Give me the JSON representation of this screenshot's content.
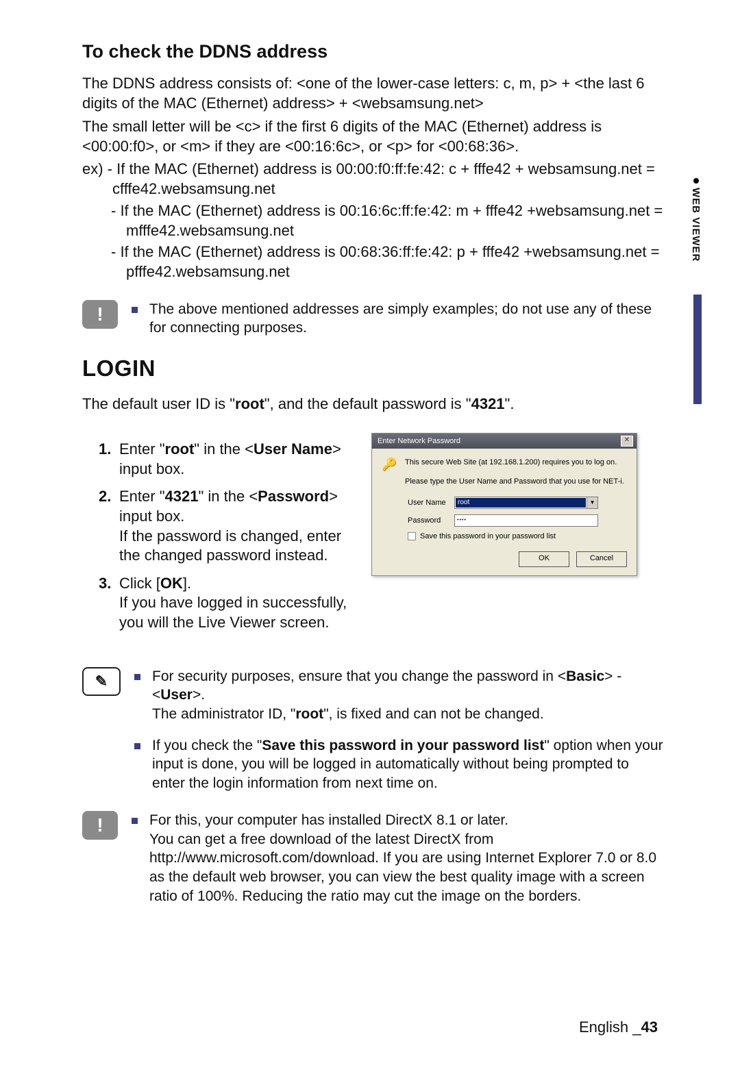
{
  "side_tab": "WEB VIEWER",
  "headings": {
    "ddns": "To check the DDNS address",
    "login": "LOGIN"
  },
  "ddns": {
    "p1": "The DDNS address consists of: <one of the lower-case letters: c, m, p> + <the last 6 digits of the MAC (Ethernet) address> + <websamsung.net>",
    "p2": "The small letter will be <c> if the first 6 digits of the MAC (Ethernet) address is <00:00:f0>, or <m> if they are <00:16:6c>, or <p> for <00:68:36>.",
    "ex_lead": "ex) - If the MAC (Ethernet) address is 00:00:f0:ff:fe:42: c + fffe42 + websamsung.net = cfffe42.websamsung.net",
    "ex2": "- If the MAC (Ethernet) address is 00:16:6c:ff:fe:42: m + fffe42 +websamsung.net = mfffe42.websamsung.net",
    "ex3": "- If the MAC (Ethernet) address is 00:68:36:ff:fe:42: p + fffe42 +websamsung.net = pfffe42.websamsung.net",
    "note1": "The above mentioned addresses are simply examples; do not use any of these for connecting purposes."
  },
  "login": {
    "intro_pre": "The default user ID is \"",
    "intro_root": "root",
    "intro_mid": "\", and the default password is \"",
    "intro_pw": "4321",
    "intro_post": "\".",
    "steps": {
      "s1_pre": "Enter \"",
      "s1_root": "root",
      "s1_mid": "\" in the <",
      "s1_un": "User Name",
      "s1_post": "> input box.",
      "s2_pre": "Enter \"",
      "s2_pw": "4321",
      "s2_mid": "\" in the <",
      "s2_pw_lbl": "Password",
      "s2_post": "> input box.",
      "s2_extra": "If the password is changed, enter the changed password instead.",
      "s3_pre": "Click [",
      "s3_ok": "OK",
      "s3_post": "].",
      "s3_extra": "If you have logged in successfully, you will the Live Viewer screen."
    },
    "num1": "1.",
    "num2": "2.",
    "num3": "3."
  },
  "dialog": {
    "title": "Enter Network Password",
    "close": "✕",
    "msg1": "This secure Web Site (at 192.168.1.200) requires you to log on.",
    "msg2": "Please type the User Name and Password that you use for NET-i.",
    "user_label": "User Name",
    "user_value": "root",
    "pw_label": "Password",
    "pw_value": "••••",
    "save_cb": "Save this password in your password list",
    "ok": "OK",
    "cancel": "Cancel",
    "arrow": "▼",
    "keys_glyph": "🔑"
  },
  "notes_after": {
    "n1_pre": "For security purposes, ensure that you change the password in <",
    "n1_basic": "Basic",
    "n1_mid": "> - <",
    "n1_user": "User",
    "n1_post": ">.",
    "n1_line2_pre": "The administrator ID, \"",
    "n1_root": "root",
    "n1_line2_post": "\", is fixed and can not be changed.",
    "n2_pre": "If you check the \"",
    "n2_bold": "Save this password in your password list",
    "n2_post": "\" option when your input is done, you will be logged in automatically without being prompted to enter the login information from next time on.",
    "n3": "For this, your computer has installed DirectX 8.1 or later.\nYou can get a free download of the latest DirectX from http://www.microsoft.com/download. If you are using Internet Explorer 7.0 or 8.0 as the default web browser, you can view the best quality image with a screen ratio of 100%. Reducing the ratio may cut the image on the borders."
  },
  "footer": {
    "lang": "English _",
    "page": "43"
  },
  "icons": {
    "excl": "!",
    "pencil": "✎"
  }
}
